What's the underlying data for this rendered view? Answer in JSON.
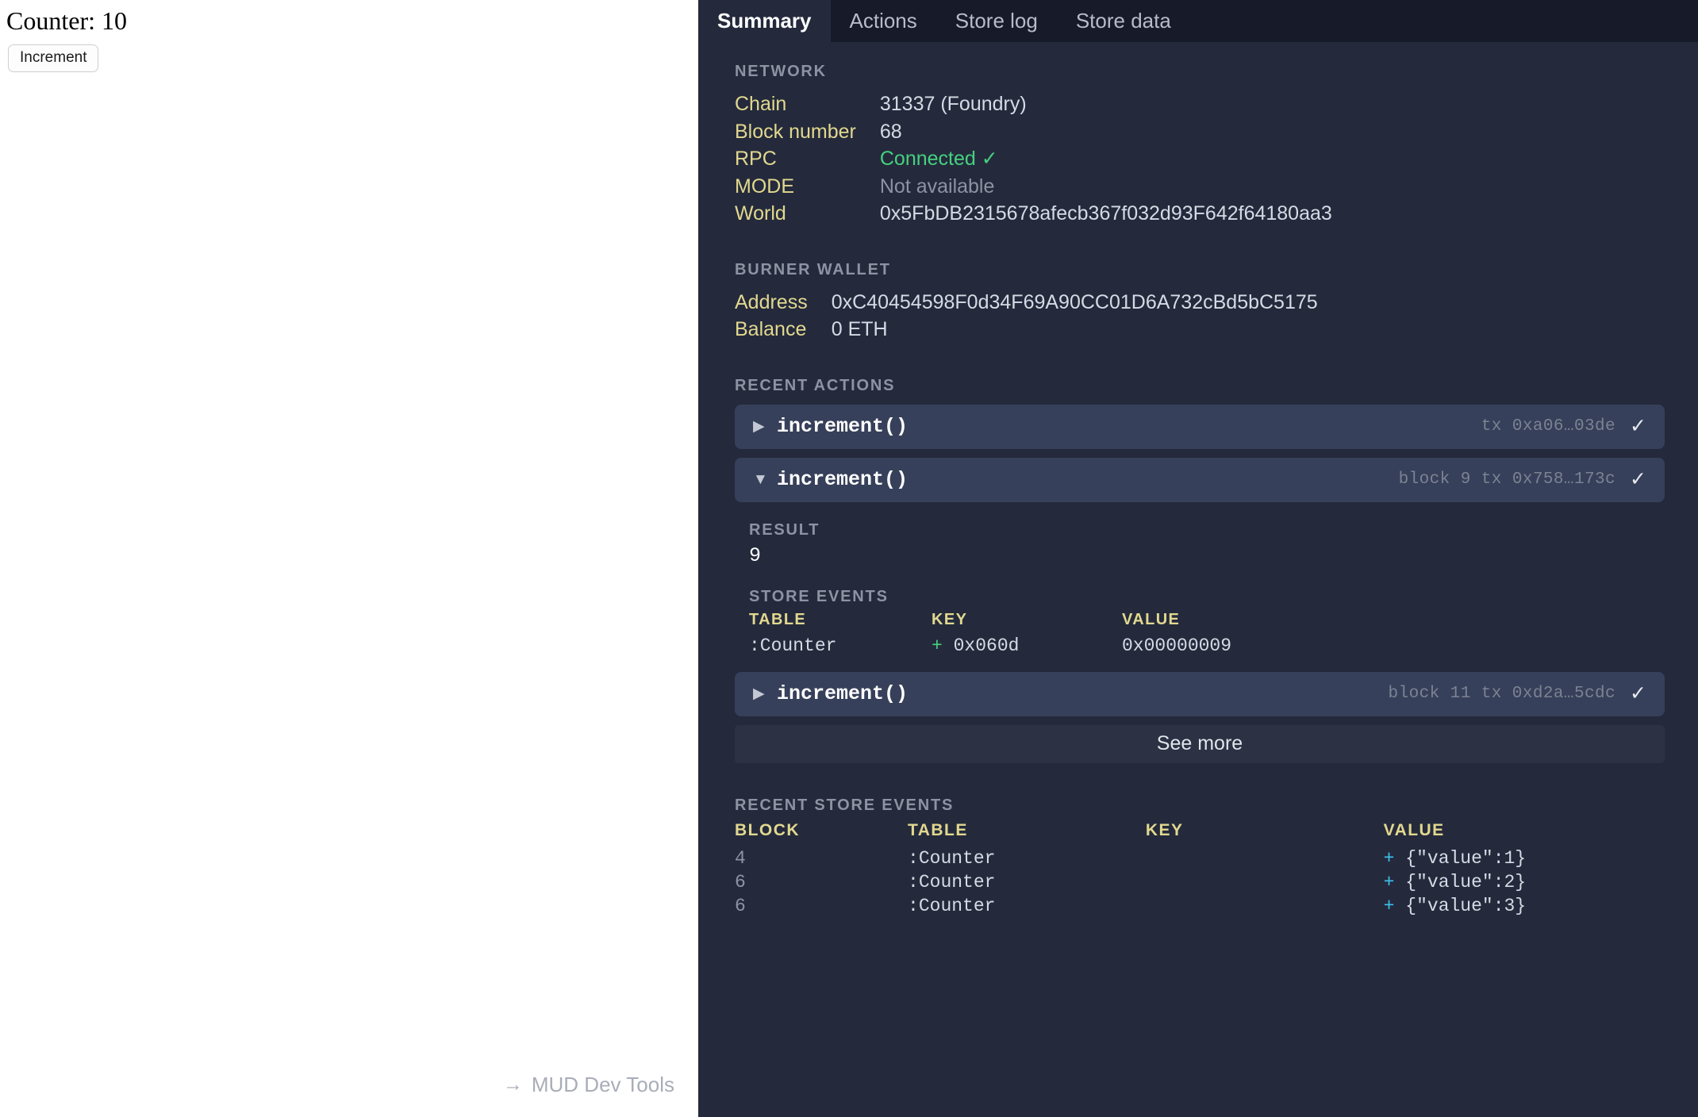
{
  "app": {
    "counter_label": "Counter: 10",
    "increment_button": "Increment",
    "devtools_link": "MUD Dev Tools",
    "devtools_arrow": "→"
  },
  "tabs": [
    {
      "label": "Summary",
      "active": true
    },
    {
      "label": "Actions",
      "active": false
    },
    {
      "label": "Store log",
      "active": false
    },
    {
      "label": "Store data",
      "active": false
    }
  ],
  "network": {
    "heading": "NETWORK",
    "rows": [
      {
        "key": "Chain",
        "value": "31337 (Foundry)",
        "style": ""
      },
      {
        "key": "Block number",
        "value": "68",
        "style": ""
      },
      {
        "key": "RPC",
        "value": "Connected ✓",
        "style": "green"
      },
      {
        "key": "MODE",
        "value": "Not available",
        "style": "muted"
      },
      {
        "key": "World",
        "value": "0x5FbDB2315678afecb367f032d93F642f64180aa3",
        "style": ""
      }
    ]
  },
  "burner_wallet": {
    "heading": "BURNER WALLET",
    "rows": [
      {
        "key": "Address",
        "value": "0xC40454598F0d34F69A90CC01D6A732cBd5bC5175",
        "style": ""
      },
      {
        "key": "Balance",
        "value": "0 ETH",
        "style": ""
      }
    ]
  },
  "recent_actions": {
    "heading": "RECENT ACTIONS",
    "see_more_label": "See more",
    "items": [
      {
        "caret": "▶",
        "name": "increment()",
        "meta": "tx 0xa06…03de",
        "status": "✓",
        "expanded": false
      },
      {
        "caret": "▼",
        "name": "increment()",
        "meta": "block 9 tx 0x758…173c",
        "status": "✓",
        "expanded": true,
        "detail": {
          "result_heading": "RESULT",
          "result_value": "9",
          "store_events_heading": "STORE EVENTS",
          "columns": [
            "TABLE",
            "KEY",
            "VALUE"
          ],
          "rows": [
            {
              "table": ":Counter",
              "key_sign": "+",
              "key": "0x060d",
              "value": "0x00000009"
            }
          ]
        }
      },
      {
        "caret": "▶",
        "name": "increment()",
        "meta": "block 11 tx 0xd2a…5cdc",
        "status": "✓",
        "expanded": false
      }
    ]
  },
  "recent_store_events": {
    "heading": "RECENT STORE EVENTS",
    "columns": [
      "BLOCK",
      "TABLE",
      "KEY",
      "VALUE"
    ],
    "rows": [
      {
        "block": "4",
        "table": ":Counter",
        "key": "",
        "value_sign": "+",
        "value": "{\"value\":1}"
      },
      {
        "block": "6",
        "table": ":Counter",
        "key": "",
        "value_sign": "+",
        "value": "{\"value\":2}"
      },
      {
        "block": "6",
        "table": ":Counter",
        "key": "",
        "value_sign": "+",
        "value": "{\"value\":3}"
      }
    ]
  },
  "colors": {
    "panel_bg": "#242a3c",
    "tabbar_bg": "#161a29",
    "accent_yellow": "#e2d88f",
    "accent_green": "#46d17f",
    "accent_blue": "#3fc0ef",
    "row_bg": "#37405a",
    "muted": "#8d93a3"
  }
}
